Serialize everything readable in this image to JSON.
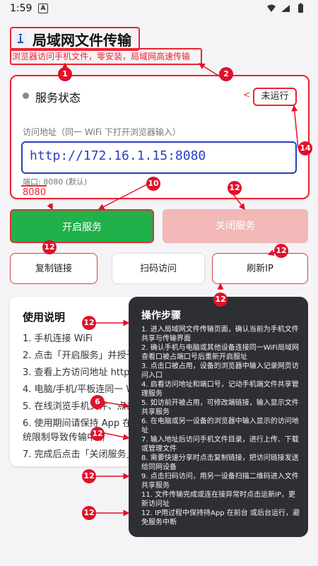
{
  "status_bar": {
    "time": "1:59",
    "app_icon_glyph": "A"
  },
  "header": {
    "title": "局域网文件传输",
    "subtitle": "浏览器访问手机文件，零安装，局域网高速传输"
  },
  "service": {
    "label": "服务状态",
    "state": "未运行",
    "access_label": "访问地址（同一 WiFi 下打开浏览器输入）",
    "url": "http://172.16.1.15:8080",
    "port_label": "端口: 8080 (默认)",
    "port_value": "8080"
  },
  "buttons": {
    "start": "开启服务",
    "stop": "关闭服务",
    "copy": "复制链接",
    "scan": "扫码访问",
    "refresh": "刷新IP"
  },
  "guide": {
    "title": "使用说明",
    "lines": [
      "1. 手机连接 WiFi",
      "2. 点击「开启服务」并授予权",
      "3. 查看上方访问地址 http://IP",
      "4. 电脑/手机/平板连同一 WiFi",
      "5. 在线浏览手机文件、点击下",
      "6. 使用期间请保持 App 在前台",
      "统限制导致传输中断",
      "7. 完成后点击「关闭服务」"
    ]
  },
  "operations": {
    "title": "操作步骤",
    "items": [
      "1. 进入局域网文件传输页面，确认当前为手机文件共享与传输界面",
      "2. 确认手机与电脑或其他设备连接同一WiFi局域网查看口被占端口号后重新开启服址",
      "3. 点击口被占用，设备的浏览器中输入记录网页访问入口",
      "4. 启看访问地址和端口号，记动手机端文件共享管理服务",
      "5. 如访前开被占用，可修改端链接，输入显示文件共享服务",
      "6. 在电脑或另一设备的浏览器中输入显示的访问地址",
      "7. 输入地址后访问手机文件目录，进行上传、下载或管理文件",
      "8. 需要快速分享时点击复制链接，把访问链接发送给同网设备",
      "9. 点击扫码访问，用另一设备扫描二维码进入文件共享服务",
      "11. 文件传输完成或连在接异常时点击运新IP，更新访问址",
      "12. IP用过程中保持持App 在前台 或后台运行，避免服务中断"
    ]
  },
  "badges": [
    "1",
    "2",
    "14",
    "10",
    "12",
    "12",
    "12",
    "12",
    "12",
    "12",
    "6",
    "12",
    "12",
    "12"
  ],
  "colors": {
    "accent_red": "#e0112b",
    "start_green": "#21b14a",
    "url_blue": "#2b3fbe",
    "panel_dark": "#2e2f33"
  }
}
